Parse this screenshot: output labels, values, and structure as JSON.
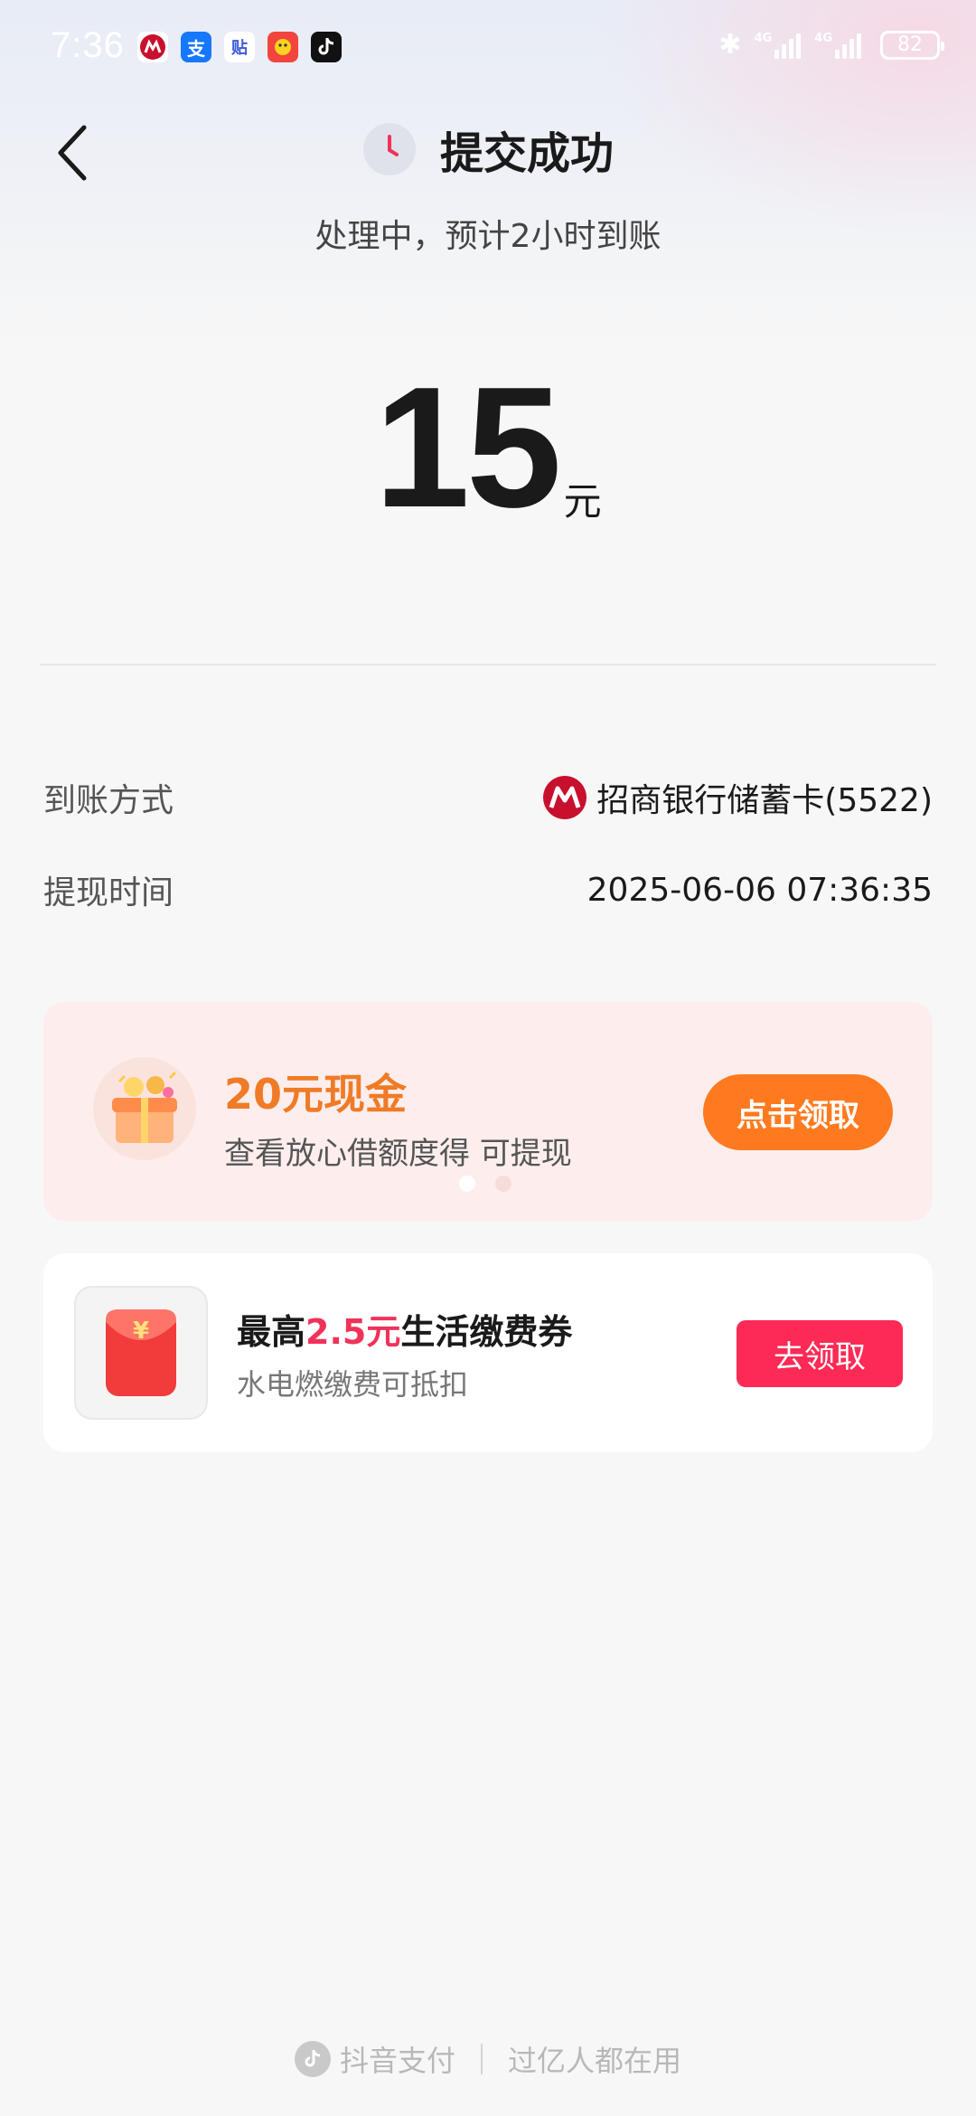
{
  "status_bar": {
    "time": "7:36",
    "battery": "82",
    "network_1": "4G",
    "network_2": "4G",
    "app_icons": [
      "cmb-icon",
      "alipay-icon",
      "tieba-icon",
      "game-icon",
      "douyin-icon"
    ]
  },
  "header": {
    "title": "提交成功",
    "subtitle": "处理中，预计2小时到账"
  },
  "amount": {
    "value": "15",
    "unit": "元"
  },
  "info": {
    "method_label": "到账方式",
    "method_value": "招商银行储蓄卡(5522)",
    "time_label": "提现时间",
    "time_value": "2025-06-06 07:36:35"
  },
  "promo": {
    "title": "20元现金",
    "description": "查看放心借额度得 可提现",
    "button": "点击领取",
    "carousel_active_index": 0,
    "carousel_count": 2
  },
  "coupon": {
    "title_prefix": "最高",
    "title_highlight": "2.5元",
    "title_suffix": "生活缴费券",
    "description": "水电燃缴费可抵扣",
    "button": "去领取",
    "envelope_symbol": "¥"
  },
  "footer": {
    "brand": "抖音支付",
    "slogan": "过亿人都在用"
  },
  "colors": {
    "promo_orange": "#ff7a1f",
    "coupon_red": "#fd2a55",
    "highlight_red": "#f0325a",
    "bank_red": "#c8102e"
  }
}
